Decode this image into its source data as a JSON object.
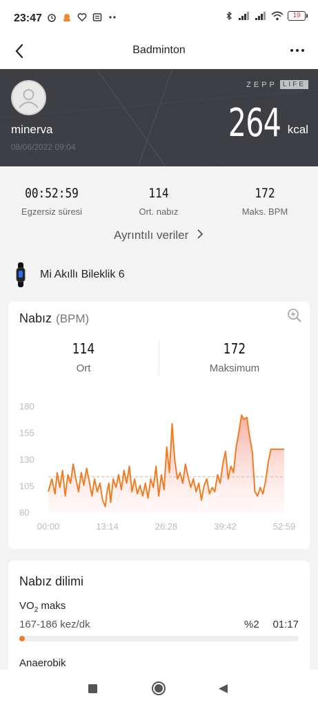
{
  "status_bar": {
    "time": "23:47",
    "battery": "19"
  },
  "header": {
    "title": "Badminton"
  },
  "hero": {
    "user_name": "minerva",
    "date": "08/06/2022 09:04",
    "brand_left": "ZEPP",
    "brand_right": "LIFE",
    "calories": "264",
    "calories_unit": "kcal"
  },
  "stats": [
    {
      "value": "00:52:59",
      "label": "Egzersiz süresi"
    },
    {
      "value": "114",
      "label": "Ort. nabız"
    },
    {
      "value": "172",
      "label": "Maks. BPM"
    }
  ],
  "detail_link": "Ayrıntılı veriler",
  "device": {
    "label": "Mi Akıllı Bileklik 6"
  },
  "heart_rate": {
    "title": "Nabız",
    "unit": "(BPM)",
    "avg_value": "114",
    "avg_label": "Ort",
    "max_value": "172",
    "max_label": "Maksimum"
  },
  "chart_data": {
    "type": "area",
    "title": "",
    "xlabel": "",
    "ylabel": "",
    "ylim": [
      80,
      180
    ],
    "yticks": [
      "180",
      "155",
      "130",
      "105",
      "80"
    ],
    "xticks": [
      "00:00",
      "13:14",
      "26:28",
      "39:42",
      "52:59"
    ],
    "xlim_minutes": [
      0,
      52.98
    ],
    "average_line": 114,
    "series": [
      {
        "x": [
          0,
          0.8,
          1.5,
          2,
          2.6,
          3.2,
          3.8,
          4.4,
          5,
          5.6,
          6.2,
          6.8,
          7.4,
          8,
          8.6,
          9.2,
          9.8,
          10.4,
          11,
          11.6,
          12.2,
          12.8,
          13.2,
          13.6,
          14,
          14.6,
          15.2,
          15.8,
          16.4,
          17,
          17.6,
          18.2,
          18.8,
          19.4,
          20,
          20.6,
          21.2,
          21.8,
          22.4,
          23,
          23.6,
          24.2,
          24.8,
          25.4,
          26,
          26.6,
          27.2,
          27.8,
          28.4,
          29,
          29.6,
          30.2,
          30.8,
          31.4,
          32,
          32.6,
          33.2,
          33.8,
          34.4,
          35,
          35.6,
          36.2,
          36.8,
          37.4,
          38,
          38.6,
          39.2,
          39.8,
          40.4,
          41,
          41.6,
          42.2,
          42.8,
          43.4,
          44,
          44.6,
          45.2,
          45.8,
          46.4,
          47,
          47.6,
          48.2,
          48.8,
          49.4,
          50,
          50.6,
          51.2,
          51.8,
          52.4,
          52.98
        ],
        "values": [
          100,
          112,
          98,
          118,
          104,
          120,
          96,
          116,
          108,
          126,
          112,
          100,
          118,
          106,
          122,
          110,
          96,
          112,
          100,
          108,
          92,
          86,
          100,
          108,
          90,
          112,
          104,
          116,
          102,
          120,
          108,
          124,
          100,
          112,
          98,
          106,
          96,
          108,
          94,
          112,
          104,
          124,
          96,
          116,
          102,
          142,
          118,
          164,
          130,
          112,
          118,
          108,
          126,
          114,
          104,
          112,
          100,
          108,
          92,
          106,
          112,
          98,
          104,
          100,
          116,
          108,
          126,
          138,
          112,
          124,
          118,
          142,
          156,
          172,
          168,
          170,
          152,
          138,
          100,
          96,
          104,
          98,
          110,
          128,
          140,
          140,
          140,
          140,
          140,
          140
        ]
      }
    ]
  },
  "zone": {
    "title": "Nabız dilimi",
    "name_main": "VO",
    "name_sub": "2",
    "name_rest": " maks",
    "range": "167-186 kez/dk",
    "percent": "%2",
    "time": "01:17",
    "fill_fraction": 0.02,
    "next_label": "Anaerobik"
  },
  "colors": {
    "accent": "#f07c21",
    "hero_bg": "#3d3f44"
  }
}
